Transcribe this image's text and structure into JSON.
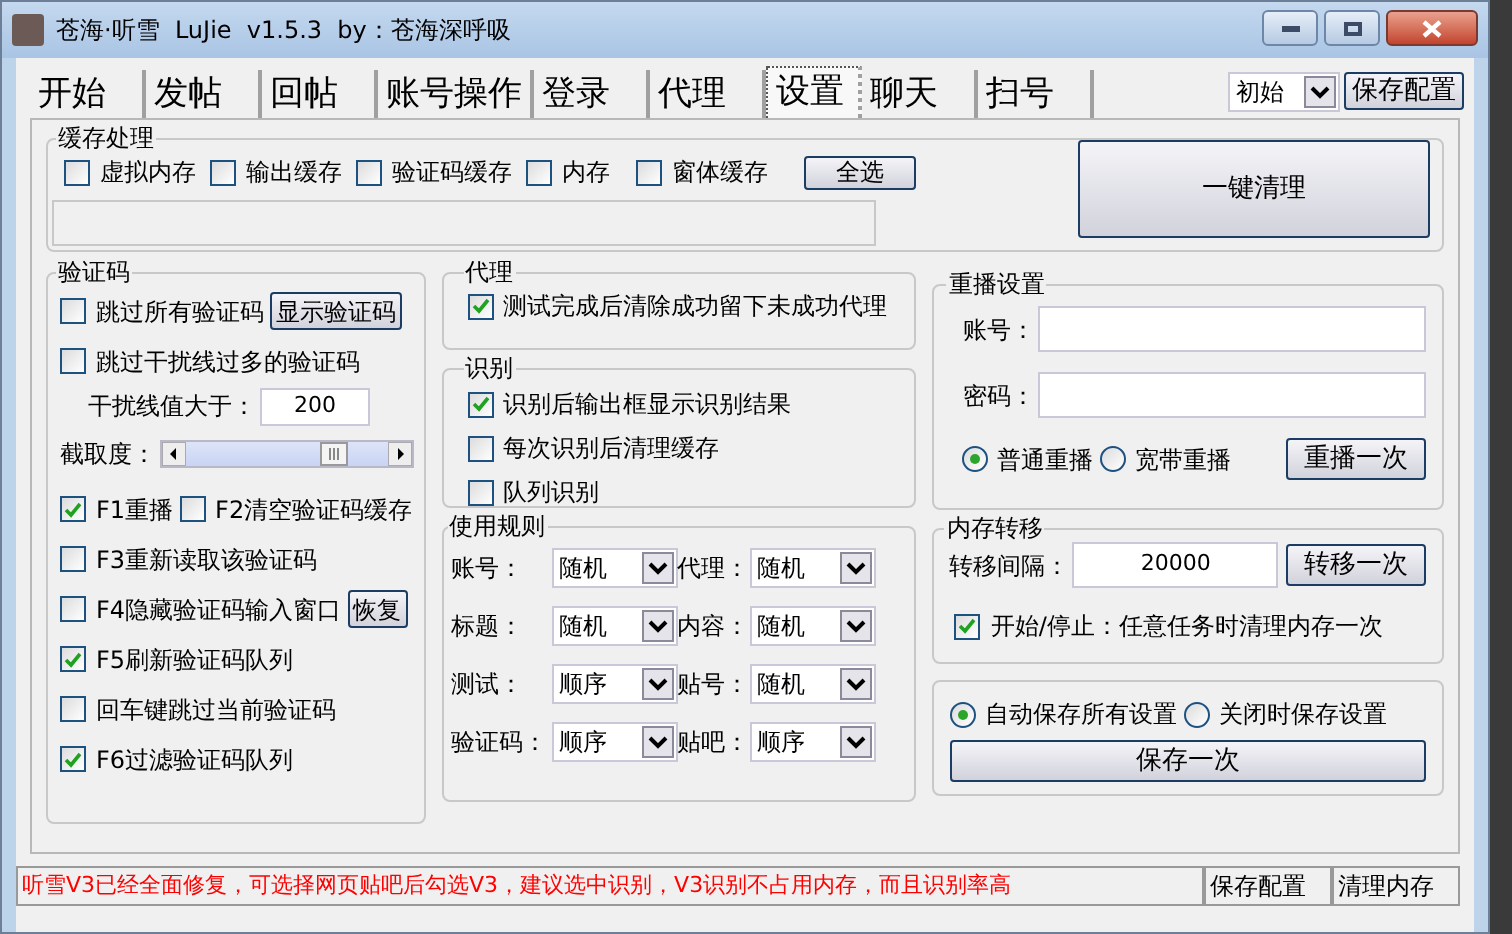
{
  "window": {
    "title": "苍海·听雪  LuJie  v1.5.3  by：苍海深呼吸"
  },
  "tabs": [
    {
      "label": "开始",
      "selected": false
    },
    {
      "label": "发帖",
      "selected": false
    },
    {
      "label": "回帖",
      "selected": false
    },
    {
      "label": "账号操作",
      "selected": false
    },
    {
      "label": "登录",
      "selected": false
    },
    {
      "label": "代理",
      "selected": false
    },
    {
      "label": "设置",
      "selected": true
    },
    {
      "label": "聊天",
      "selected": false
    },
    {
      "label": "扫号",
      "selected": false
    }
  ],
  "profile_select": {
    "value": "初始"
  },
  "save_config_button": "保存配置",
  "cache_group": {
    "title": "缓存处理",
    "options": [
      {
        "label": "虚拟内存",
        "checked": false
      },
      {
        "label": "输出缓存",
        "checked": false
      },
      {
        "label": "验证码缓存",
        "checked": false
      },
      {
        "label": "内存",
        "checked": false
      },
      {
        "label": "窗体缓存",
        "checked": false
      }
    ],
    "select_all_button": "全选",
    "clean_button": "一键清理"
  },
  "captcha_group": {
    "title": "验证码",
    "items": [
      {
        "kind": "checkbox",
        "label": "跳过所有验证码",
        "checked": false,
        "button": "显示验证码"
      },
      {
        "kind": "checkbox",
        "label": "跳过干扰线过多的验证码",
        "checked": false
      },
      {
        "kind": "input",
        "label": "干扰线值大于：",
        "value": "200"
      },
      {
        "kind": "slider",
        "label": "截取度：",
        "level": 0.8
      },
      {
        "kind": "pair",
        "options": [
          {
            "label": "F1重播",
            "checked": true
          },
          {
            "label": "F2清空验证码缓存",
            "checked": false
          }
        ]
      },
      {
        "kind": "checkbox",
        "label": "F3重新读取该验证码",
        "checked": false
      },
      {
        "kind": "checkbox",
        "label": "F4隐藏验证码输入窗口",
        "checked": false,
        "button": "恢复"
      },
      {
        "kind": "checkbox",
        "label": "F5刷新验证码队列",
        "checked": true
      },
      {
        "kind": "checkbox",
        "label": "回车键跳过当前验证码",
        "checked": false
      },
      {
        "kind": "checkbox",
        "label": "F6过滤验证码队列",
        "checked": true
      }
    ]
  },
  "proxy_group": {
    "title": "代理",
    "options": [
      {
        "label": "测试完成后清除成功留下未成功代理",
        "checked": true
      }
    ]
  },
  "recognition_group": {
    "title": "识别",
    "options": [
      {
        "label": "识别后输出框显示识别结果",
        "checked": true
      },
      {
        "label": "每次识别后清理缓存",
        "checked": false
      },
      {
        "label": "队列识别",
        "checked": false
      }
    ]
  },
  "rules_group": {
    "title": "使用规则",
    "fields": [
      {
        "label": "账号：",
        "value": "随机"
      },
      {
        "label": "代理：",
        "value": "随机"
      },
      {
        "label": "标题：",
        "value": "随机"
      },
      {
        "label": "内容：",
        "value": "随机"
      },
      {
        "label": "测试：",
        "value": "顺序"
      },
      {
        "label": "贴号：",
        "value": "随机"
      },
      {
        "label": "验证码：",
        "value": "顺序"
      },
      {
        "label": "贴吧：",
        "value": "顺序"
      }
    ]
  },
  "replay_group": {
    "title": "重播设置",
    "fields": [
      {
        "label": "账号："
      },
      {
        "label": "密码："
      }
    ],
    "modes": [
      {
        "label": "普通重播",
        "selected": true
      },
      {
        "label": "宽带重播",
        "selected": false
      }
    ],
    "button": "重播一次"
  },
  "memory_group": {
    "title": "内存转移",
    "interval_label": "转移间隔：",
    "interval_value": "20000",
    "button": "转移一次",
    "option": {
      "label": "开始/停止：任意任务时清理内存一次",
      "checked": true
    }
  },
  "save_group": {
    "modes": [
      {
        "label": "自动保存所有设置",
        "selected": true
      },
      {
        "label": "关闭时保存设置",
        "selected": false
      }
    ],
    "button": "保存一次"
  },
  "status_bar": {
    "message": "听雪V3已经全面修复，可选择网页贴吧后勾选V3，建议选中识别，V3识别不占用内存，而且识别率高",
    "buttons": [
      "保存配置",
      "清理内存"
    ]
  }
}
